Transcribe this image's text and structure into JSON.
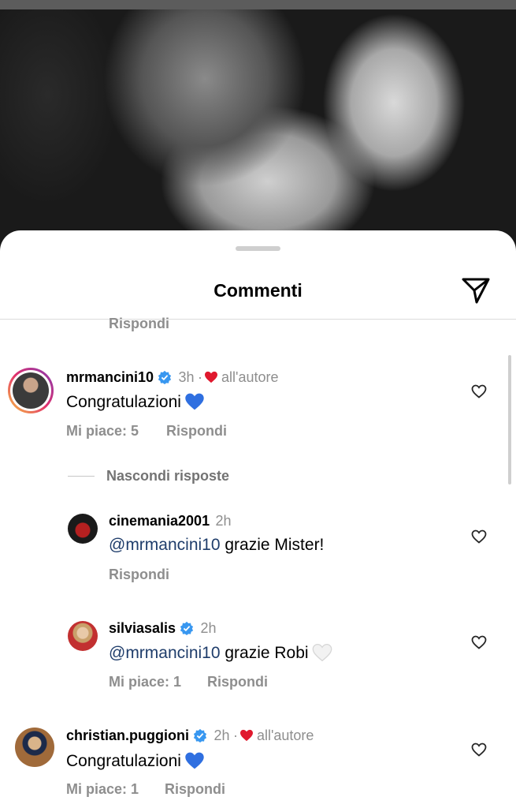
{
  "sheet": {
    "title": "Commenti",
    "icons": {
      "share": "send-icon",
      "like": "heart-outline-icon",
      "verified": "verified-badge-icon"
    }
  },
  "previous_comment": {
    "reply_label": "Rispondi"
  },
  "comments": [
    {
      "username": "mrmancini10",
      "verified": true,
      "time": "3h",
      "separator": "·",
      "liked_by_author": "all'autore",
      "text": "Congratulazioni",
      "emoji": "blue-heart",
      "likes_label": "Mi piace: 5",
      "reply_label": "Rispondi",
      "hide_replies_label": "Nascondi risposte",
      "replies": [
        {
          "username": "cinemania2001",
          "verified": false,
          "time": "2h",
          "mention": "@mrmancini10",
          "text": " grazie Mister!",
          "reply_label": "Rispondi"
        },
        {
          "username": "silviasalis",
          "verified": true,
          "time": "2h",
          "mention": "@mrmancini10",
          "text": " grazie Robi",
          "emoji": "white-heart",
          "likes_label": "Mi piace: 1",
          "reply_label": "Rispondi"
        }
      ]
    },
    {
      "username": "christian.puggioni",
      "verified": true,
      "time": "2h",
      "separator": "·",
      "liked_by_author": "all'autore",
      "text": "Congratulazioni",
      "emoji": "blue-heart",
      "likes_label": "Mi piace: 1",
      "reply_label": "Rispondi"
    }
  ],
  "colors": {
    "accent_mention": "#1f3d6b",
    "meta_gray": "#8e8e8e",
    "heart_red": "#e0192e",
    "verified_blue": "#3897f0",
    "blue_heart": "#2f6fe0"
  }
}
